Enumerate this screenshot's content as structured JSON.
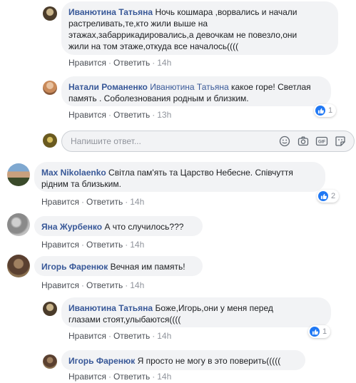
{
  "comments": [
    {
      "author": "Иванютина Татьяна",
      "lines": [
        "Ночь кошмара ,ворвались и начали",
        "растреливать,те,кто жили выше на",
        "этажах,забаррикадировались,а девочкам не повезло,они",
        "жили на том этаже,откуда все началось(((("
      ],
      "actions": {
        "like": "Нравится",
        "reply": "Ответить",
        "time": "14h"
      }
    },
    {
      "author": "Натали Романенко",
      "tag": "Иванютина Татьяна",
      "lines_after_tag": [
        "какое горе! Светлая",
        "память . Соболезнования родным и близким."
      ],
      "actions": {
        "like": "Нравится",
        "reply": "Ответить",
        "time": "13h"
      },
      "reactions": 1
    },
    {
      "author": "Max Nikolaenko",
      "lines": [
        "Світла пам'ять та Царство Небесне. Співчуття",
        "рідним та близьким."
      ],
      "actions": {
        "like": "Нравится",
        "reply": "Ответить",
        "time": "14h"
      },
      "reactions": 2
    },
    {
      "author": "Яна Журбенко",
      "lines": [
        "А что случилось???"
      ],
      "actions": {
        "like": "Нравится",
        "reply": "Ответить",
        "time": "14h"
      }
    },
    {
      "author": "Игорь Фаренюк",
      "lines": [
        "Вечная им память!"
      ],
      "actions": {
        "like": "Нравится",
        "reply": "Ответить",
        "time": "14h"
      }
    },
    {
      "author": "Иванютина Татьяна",
      "lines": [
        "Боже,Игорь,они у меня перед",
        "глазами стоят,улыбаются(((("
      ],
      "actions": {
        "like": "Нравится",
        "reply": "Ответить",
        "time": "14h"
      },
      "reactions": 1
    },
    {
      "author": "Игорь Фаренюк",
      "lines": [
        "Я просто не могу в это поверить((((("
      ],
      "actions": {
        "like": "Нравится",
        "reply": "Ответить",
        "time": "14h"
      }
    }
  ],
  "reply_box": {
    "placeholder": "Напишите ответ..."
  },
  "icons": [
    "emoji-icon",
    "camera-icon",
    "gif-icon",
    "sticker-icon"
  ],
  "colors": {
    "name_link": "#385898",
    "bubble_bg": "#f2f3f5",
    "like_blue": "#2078f4",
    "meta_gray": "#90949c"
  }
}
